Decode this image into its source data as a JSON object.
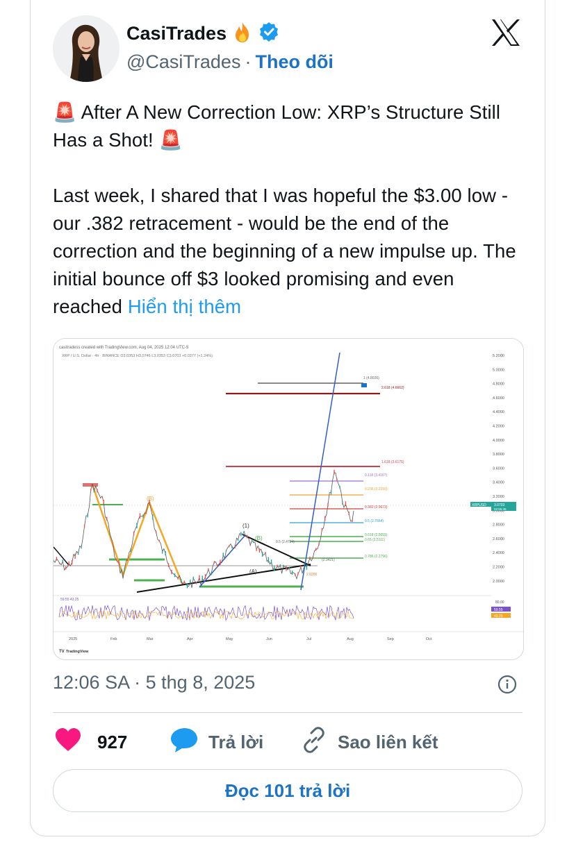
{
  "author": {
    "name": "CasiTrades",
    "handle": "@CasiTrades",
    "separator": "·",
    "follow_label": "Theo dõi"
  },
  "tweet": {
    "headline": "🚨 After A New Correction Low: XRP’s Structure Still Has a Shot! 🚨",
    "body": "Last week, I shared that I was hopeful the $3.00 low - our .382 retracement - would be the end of the correction and the beginning of a new impulse up. The initial bounce off $3 looked promising and even reached",
    "show_more": "Hiển thị thêm"
  },
  "chart_image": {
    "header": "casitradess created with TradingView.com, Aug 04, 2025 12:04 UTC-5",
    "symbol_line": "XRP / U.S. Dollar · 4h · BINANCE  O3.0353 H3.0746 L3.0353 C3.0703 +0.0377 (+1.24%)",
    "price_ticks": [
      "5.2000",
      "5.0000",
      "4.8000",
      "4.6000",
      "4.4000",
      "4.2000",
      "4.0000",
      "3.8000",
      "3.6000",
      "3.4000",
      "3.2000",
      "3.0000",
      "2.8000",
      "2.6000",
      "2.4000",
      "2.2000",
      "2.0000"
    ],
    "month_labels": [
      "2025",
      "Feb",
      "Mar",
      "Apr",
      "May",
      "Jun",
      "Jul",
      "Aug",
      "Sep",
      "Oct"
    ],
    "fib_labels": [
      "1 (4.8026)",
      "2.618 (4.6662)",
      "1.618 (3.6175)",
      "0.118 (3.4167)",
      "0.236 (3.2150)",
      "0.382 (2.9673)",
      "0.5 (2.7664)",
      "0.618 (2.5655)",
      "0.65 (2.5111)",
      "0.786 (2.2796)",
      "0.5 (2.4724)",
      "(2.3421)",
      "2.0200"
    ],
    "wave_labels": [
      "(B)",
      "(1)",
      "(B)",
      "(A)"
    ],
    "price_tag_symbol": "XRPUSD",
    "price_tag_value": "3.0703",
    "price_tag_timer": "02:55:45",
    "rsi_label": "59.55  43.25",
    "rsi_ticks": [
      "80.00",
      "59.55",
      "43.25"
    ],
    "tv_logo": "TradingView"
  },
  "meta": {
    "time": "12:06 SA",
    "dot": "·",
    "date": "5 thg 8, 2025"
  },
  "actions": {
    "likes": "927",
    "reply_label": "Trả lời",
    "copy_link_label": "Sao liên kết",
    "read_replies_label": "Đọc 101 trả lời"
  },
  "colors": {
    "like": "#f91880",
    "reply": "#1d9bf0",
    "follow": "#1d72c4",
    "verified": "#1d9bf0"
  }
}
